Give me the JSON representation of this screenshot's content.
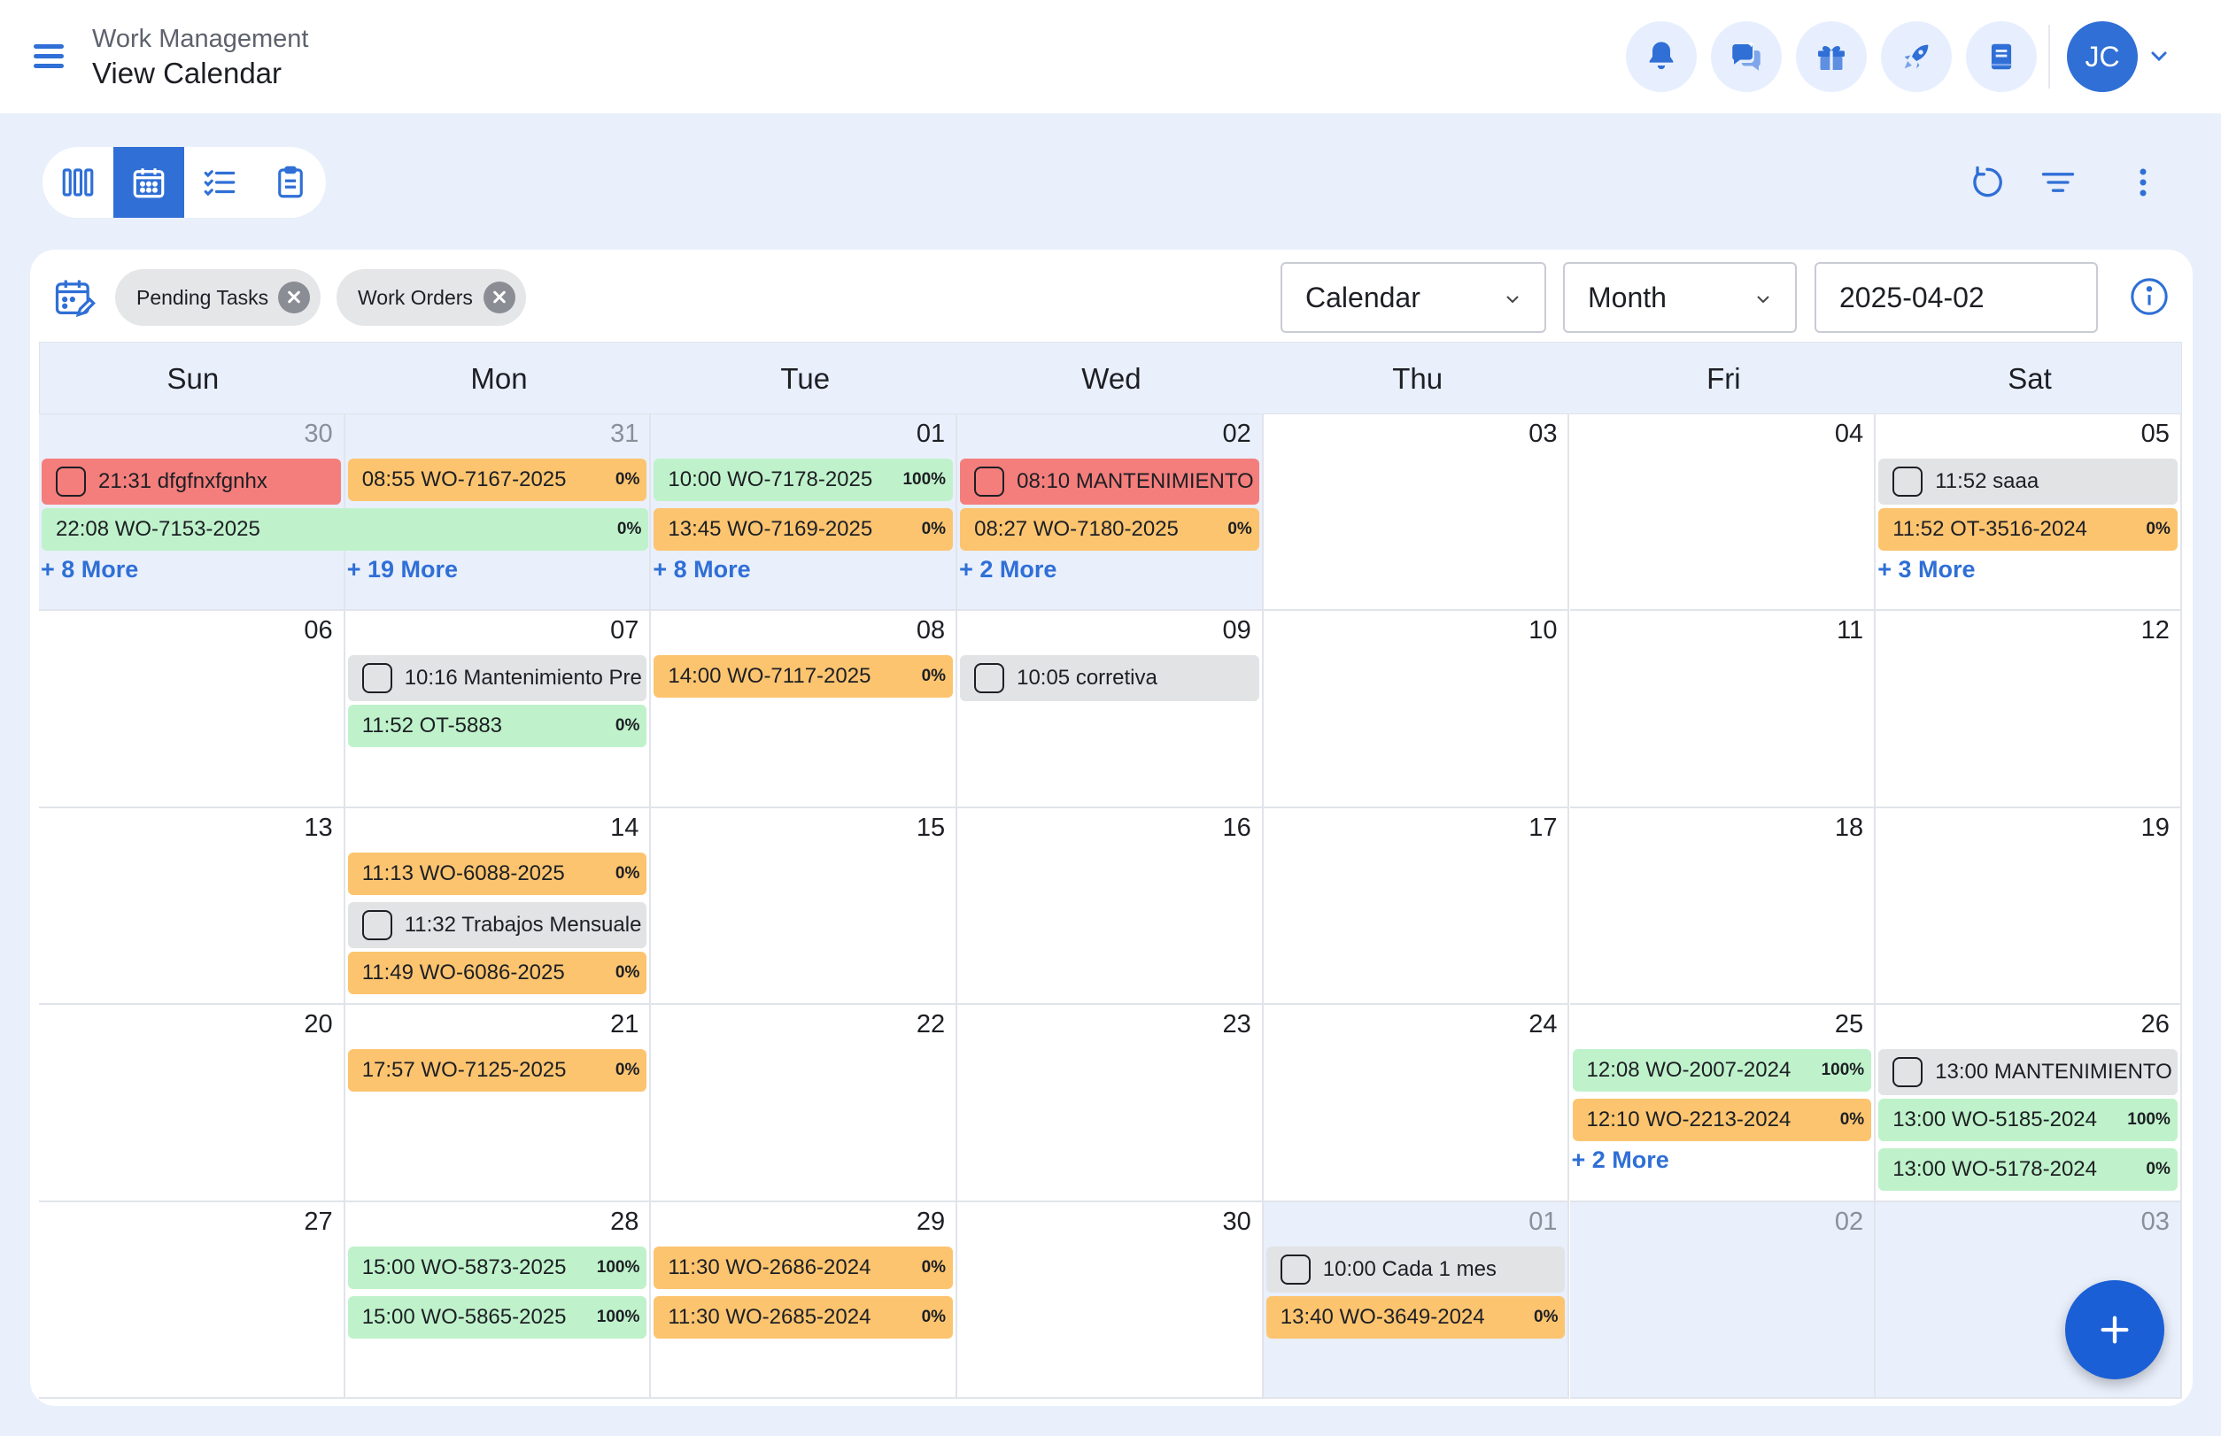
{
  "header": {
    "breadcrumb_parent": "Work Management",
    "title": "View Calendar",
    "icons": [
      "bell-icon",
      "chat-icon",
      "gift-icon",
      "rocket-icon",
      "book-icon"
    ],
    "avatar_initials": "JC"
  },
  "toolbar": {
    "views": [
      "columns-view",
      "calendar-view",
      "checklist-view",
      "clipboard-view"
    ],
    "active_view": "calendar-view"
  },
  "filters": {
    "chips": [
      "Pending Tasks",
      "Work Orders"
    ],
    "view_select": "Calendar",
    "range_select": "Month",
    "date_value": "2025-04-02"
  },
  "calendar": {
    "weekdays": [
      "Sun",
      "Mon",
      "Tue",
      "Wed",
      "Thu",
      "Fri",
      "Sat"
    ],
    "weeks": [
      [
        {
          "day": "30",
          "muted": true,
          "shaded": true,
          "events": [
            {
              "text": "21:31 dfgfnxfgnhx",
              "color": "red",
              "check": true
            }
          ],
          "more": "+ 8 More"
        },
        {
          "day": "31",
          "muted": true,
          "shaded": true,
          "events": [
            {
              "text": "08:55 WO-7167-2025",
              "color": "orange",
              "pct": "0%"
            }
          ],
          "more": "+ 19 More"
        },
        {
          "day": "01",
          "shaded": true,
          "events": [
            {
              "text": "10:00 WO-7178-2025",
              "color": "green",
              "pct": "100%"
            },
            {
              "text": "13:45 WO-7169-2025",
              "color": "orange",
              "pct": "0%"
            }
          ],
          "more": "+ 8 More"
        },
        {
          "day": "02",
          "shaded": true,
          "events": [
            {
              "text": "08:10 MANTENIMIENTO",
              "color": "red",
              "check": true
            },
            {
              "text": "08:27 WO-7180-2025",
              "color": "orange",
              "pct": "0%"
            }
          ],
          "more": "+ 2 More"
        },
        {
          "day": "03",
          "events": []
        },
        {
          "day": "04",
          "events": []
        },
        {
          "day": "05",
          "events": [
            {
              "text": "11:52 saaa",
              "color": "gray",
              "check": true
            },
            {
              "text": "11:52 OT-3516-2024",
              "color": "orange",
              "pct": "0%"
            }
          ],
          "more": "+ 3 More"
        }
      ],
      [
        {
          "day": "06",
          "events": []
        },
        {
          "day": "07",
          "events": [
            {
              "text": "10:16 Mantenimiento Pre",
              "color": "gray",
              "check": true
            },
            {
              "text": "11:52 OT-5883",
              "color": "green",
              "pct": "0%"
            }
          ]
        },
        {
          "day": "08",
          "events": [
            {
              "text": "14:00 WO-7117-2025",
              "color": "orange",
              "pct": "0%"
            }
          ]
        },
        {
          "day": "09",
          "events": [
            {
              "text": "10:05 corretiva",
              "color": "gray",
              "check": true
            }
          ]
        },
        {
          "day": "10",
          "events": []
        },
        {
          "day": "11",
          "events": []
        },
        {
          "day": "12",
          "events": []
        }
      ],
      [
        {
          "day": "13",
          "events": []
        },
        {
          "day": "14",
          "events": [
            {
              "text": "11:13 WO-6088-2025",
              "color": "orange",
              "pct": "0%"
            },
            {
              "text": "11:32 Trabajos Mensuale",
              "color": "gray",
              "check": true
            },
            {
              "text": "11:49 WO-6086-2025",
              "color": "orange",
              "pct": "0%"
            }
          ]
        },
        {
          "day": "15",
          "events": []
        },
        {
          "day": "16",
          "events": []
        },
        {
          "day": "17",
          "events": []
        },
        {
          "day": "18",
          "events": []
        },
        {
          "day": "19",
          "events": []
        }
      ],
      [
        {
          "day": "20",
          "events": []
        },
        {
          "day": "21",
          "events": [
            {
              "text": "17:57 WO-7125-2025",
              "color": "orange",
              "pct": "0%"
            }
          ]
        },
        {
          "day": "22",
          "events": []
        },
        {
          "day": "23",
          "events": []
        },
        {
          "day": "24",
          "events": []
        },
        {
          "day": "25",
          "events": [
            {
              "text": "12:08 WO-2007-2024",
              "color": "green",
              "pct": "100%"
            },
            {
              "text": "12:10 WO-2213-2024",
              "color": "orange",
              "pct": "0%"
            }
          ],
          "more": "+ 2 More"
        },
        {
          "day": "26",
          "events": [
            {
              "text": "13:00 MANTENIMIENTO ...",
              "color": "gray",
              "check": true
            },
            {
              "text": "13:00 WO-5185-2024",
              "color": "green",
              "pct": "100%"
            },
            {
              "text": "13:00 WO-5178-2024",
              "color": "green",
              "pct": "0%"
            }
          ]
        }
      ],
      [
        {
          "day": "27",
          "events": []
        },
        {
          "day": "28",
          "events": [
            {
              "text": "15:00 WO-5873-2025",
              "color": "green",
              "pct": "100%"
            },
            {
              "text": "15:00 WO-5865-2025",
              "color": "green",
              "pct": "100%"
            }
          ]
        },
        {
          "day": "29",
          "events": [
            {
              "text": "11:30 WO-2686-2024",
              "color": "orange",
              "pct": "0%"
            },
            {
              "text": "11:30 WO-2685-2024",
              "color": "orange",
              "pct": "0%"
            }
          ]
        },
        {
          "day": "30",
          "events": []
        },
        {
          "day": "01",
          "muted": true,
          "shaded": true,
          "events": [
            {
              "text": "10:00 Cada 1 mes",
              "color": "gray",
              "check": true
            },
            {
              "text": "13:40 WO-3649-2024",
              "color": "orange",
              "pct": "0%"
            }
          ]
        },
        {
          "day": "02",
          "muted": true,
          "shaded": true,
          "events": []
        },
        {
          "day": "03",
          "muted": true,
          "shaded": true,
          "events": []
        }
      ]
    ],
    "spanning_event": {
      "text": "22:08 WO-7153-2025",
      "color": "green",
      "pct": "0%"
    }
  },
  "colors": {
    "accent": "#2f6fd6",
    "green": "#bff2cb",
    "orange": "#fcc46f",
    "red": "#f47e7c",
    "gray": "#e2e3e5",
    "background": "#e9effb"
  },
  "fab": {
    "icon": "plus-icon"
  }
}
